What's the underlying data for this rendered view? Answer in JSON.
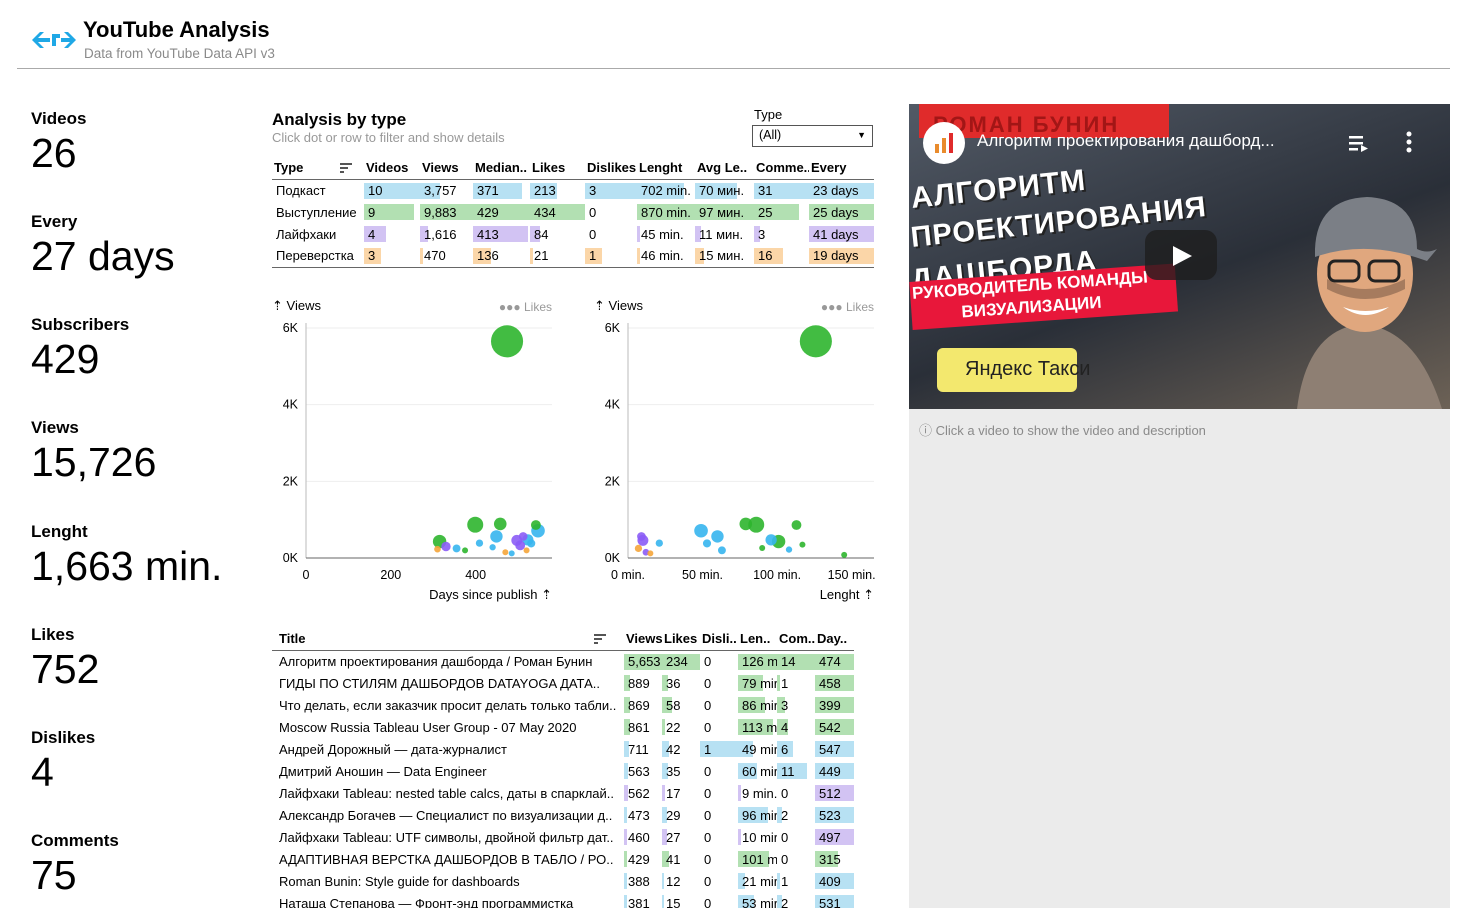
{
  "header": {
    "title": "YouTube Analysis",
    "subtitle": "Data from YouTube Data API v3"
  },
  "kpis": [
    {
      "label": "Videos",
      "value": "26"
    },
    {
      "label": "Every",
      "value": "27 days"
    },
    {
      "label": "Subscribers",
      "value": "429"
    },
    {
      "label": "Views",
      "value": "15,726"
    },
    {
      "label": "Lenght",
      "value": "1,663 min."
    },
    {
      "label": "Likes",
      "value": "752"
    },
    {
      "label": "Dislikes",
      "value": "4"
    },
    {
      "label": "Comments",
      "value": "75"
    }
  ],
  "analysis": {
    "title": "Analysis by type",
    "hint": "Click dot or row to filter and show details",
    "filter_label": "Type",
    "filter_value": "(All)"
  },
  "colors": {
    "Подкаст": "#b7e1f3",
    "Выступление": "#b2e0b2",
    "Лайфхаки": "#d2c3f3",
    "Переверстка": "#fbd6a8",
    "dot_blue": "#36b5ee",
    "dot_green": "#2db52d",
    "dot_purple": "#8b5cf6",
    "dot_orange": "#f5a53a"
  },
  "type_table": {
    "headers": [
      "Type",
      "Videos",
      "Views",
      "Median..",
      "Likes",
      "Dislikes",
      "Lenght",
      "Avg Le..",
      "Comme..",
      "Every"
    ],
    "rows": [
      {
        "type": "Подкаст",
        "cells": [
          "10",
          "3,757",
          "371",
          "213",
          "3",
          "702 min.",
          "70 мин.",
          "31",
          "23 days"
        ],
        "fill": [
          1.0,
          0.38,
          0.86,
          0.49,
          1.0,
          0.81,
          0.72,
          1.0,
          1.0
        ]
      },
      {
        "type": "Выступление",
        "cells": [
          "9",
          "9,883",
          "429",
          "434",
          "0",
          "870 min.",
          "97 мин.",
          "25",
          "25 days"
        ],
        "fill": [
          0.9,
          1.0,
          1.0,
          1.0,
          0.0,
          1.0,
          1.0,
          0.81,
          1.0
        ]
      },
      {
        "type": "Лайфхаки",
        "cells": [
          "4",
          "1,616",
          "413",
          "84",
          "0",
          "45 min.",
          "11 мин.",
          "3",
          "41 days"
        ],
        "fill": [
          0.4,
          0.16,
          0.96,
          0.19,
          0.0,
          0.05,
          0.11,
          0.1,
          1.0
        ]
      },
      {
        "type": "Переверстка",
        "cells": [
          "3",
          "470",
          "136",
          "21",
          "1",
          "46 min.",
          "15 мин.",
          "16",
          "19 days"
        ],
        "fill": [
          0.3,
          0.05,
          0.32,
          0.05,
          0.33,
          0.05,
          0.15,
          0.52,
          1.0
        ]
      }
    ]
  },
  "chart_data": [
    {
      "type": "scatter",
      "title": "",
      "ylabel": "Views",
      "xlabel": "Days since publish",
      "legend": "Likes",
      "x_ticks": [
        "0",
        "200",
        "400"
      ],
      "y_ticks": [
        "0K",
        "2K",
        "4K",
        "6K"
      ],
      "xlim": [
        0,
        580
      ],
      "ylim": [
        0,
        6000
      ],
      "points": [
        {
          "x": 474,
          "y": 5653,
          "likes": 234,
          "type": "Выступление"
        },
        {
          "x": 458,
          "y": 889,
          "likes": 36,
          "type": "Выступление"
        },
        {
          "x": 399,
          "y": 869,
          "likes": 58,
          "type": "Выступление"
        },
        {
          "x": 542,
          "y": 861,
          "likes": 22,
          "type": "Выступление"
        },
        {
          "x": 547,
          "y": 711,
          "likes": 42,
          "type": "Подкаст"
        },
        {
          "x": 449,
          "y": 563,
          "likes": 35,
          "type": "Подкаст"
        },
        {
          "x": 512,
          "y": 562,
          "likes": 17,
          "type": "Лайфхаки"
        },
        {
          "x": 523,
          "y": 473,
          "likes": 29,
          "type": "Подкаст"
        },
        {
          "x": 497,
          "y": 460,
          "likes": 27,
          "type": "Лайфхаки"
        },
        {
          "x": 315,
          "y": 429,
          "likes": 41,
          "type": "Выступление"
        },
        {
          "x": 409,
          "y": 388,
          "likes": 12,
          "type": "Подкаст"
        },
        {
          "x": 531,
          "y": 381,
          "likes": 15,
          "type": "Подкаст"
        },
        {
          "x": 330,
          "y": 300,
          "likes": 20,
          "type": "Лайфхаки"
        },
        {
          "x": 310,
          "y": 230,
          "likes": 10,
          "type": "Переверстка"
        },
        {
          "x": 355,
          "y": 250,
          "likes": 14,
          "type": "Подкаст"
        },
        {
          "x": 375,
          "y": 200,
          "likes": 8,
          "type": "Выступление"
        },
        {
          "x": 440,
          "y": 280,
          "likes": 9,
          "type": "Подкаст"
        },
        {
          "x": 470,
          "y": 150,
          "likes": 7,
          "type": "Переверстка"
        },
        {
          "x": 485,
          "y": 120,
          "likes": 6,
          "type": "Подкаст"
        },
        {
          "x": 505,
          "y": 330,
          "likes": 22,
          "type": "Лайфхаки"
        },
        {
          "x": 520,
          "y": 200,
          "likes": 8,
          "type": "Переверстка"
        }
      ]
    },
    {
      "type": "scatter",
      "title": "",
      "ylabel": "Views",
      "xlabel": "Lenght",
      "legend": "Likes",
      "x_ticks": [
        "0 min.",
        "50 min.",
        "100 min.",
        "150 min."
      ],
      "y_ticks": [
        "0K",
        "2K",
        "4K",
        "6K"
      ],
      "xlim": [
        0,
        165
      ],
      "ylim": [
        0,
        6000
      ],
      "points": [
        {
          "x": 126,
          "y": 5653,
          "likes": 234,
          "type": "Выступление"
        },
        {
          "x": 79,
          "y": 889,
          "likes": 36,
          "type": "Выступление"
        },
        {
          "x": 86,
          "y": 869,
          "likes": 58,
          "type": "Выступление"
        },
        {
          "x": 113,
          "y": 861,
          "likes": 22,
          "type": "Выступление"
        },
        {
          "x": 49,
          "y": 711,
          "likes": 42,
          "type": "Подкаст"
        },
        {
          "x": 60,
          "y": 563,
          "likes": 35,
          "type": "Подкаст"
        },
        {
          "x": 9,
          "y": 562,
          "likes": 17,
          "type": "Лайфхаки"
        },
        {
          "x": 96,
          "y": 473,
          "likes": 29,
          "type": "Подкаст"
        },
        {
          "x": 10,
          "y": 460,
          "likes": 27,
          "type": "Лайфхаки"
        },
        {
          "x": 101,
          "y": 429,
          "likes": 41,
          "type": "Выступление"
        },
        {
          "x": 21,
          "y": 388,
          "likes": 12,
          "type": "Подкаст"
        },
        {
          "x": 53,
          "y": 381,
          "likes": 15,
          "type": "Подкаст"
        },
        {
          "x": 7,
          "y": 250,
          "likes": 12,
          "type": "Переверстка"
        },
        {
          "x": 12,
          "y": 150,
          "likes": 10,
          "type": "Лайфхаки"
        },
        {
          "x": 15,
          "y": 120,
          "likes": 6,
          "type": "Переверстка"
        },
        {
          "x": 63,
          "y": 200,
          "likes": 14,
          "type": "Подкаст"
        },
        {
          "x": 90,
          "y": 260,
          "likes": 8,
          "type": "Выступление"
        },
        {
          "x": 117,
          "y": 350,
          "likes": 6,
          "type": "Выступление"
        },
        {
          "x": 145,
          "y": 80,
          "likes": 5,
          "type": "Выступление"
        },
        {
          "x": 108,
          "y": 220,
          "likes": 9,
          "type": "Подкаст"
        }
      ]
    }
  ],
  "video_table": {
    "headers": [
      "Title",
      "Views",
      "Likes",
      "Disli..",
      "Len..",
      "Com..",
      "Day.."
    ],
    "rows": [
      {
        "type": "Выступление",
        "title": "Алгоритм проектирования дашборда / Роман Бунин",
        "cells": [
          "5,653",
          "234",
          "0",
          "126 m",
          "14",
          "474"
        ],
        "fill": [
          1.0,
          1.0,
          0.0,
          1.0,
          1.0,
          1.0
        ]
      },
      {
        "type": "Выступление",
        "title": "ГИДЫ ПО СТИЛЯМ ДАШБОРДОВ   DATAYOGA ДАТА..",
        "cells": [
          "889",
          "36",
          "0",
          "79 mir",
          "1",
          "458"
        ],
        "fill": [
          0.16,
          0.15,
          0.0,
          0.63,
          0.07,
          1.0
        ]
      },
      {
        "type": "Выступление",
        "title": "Что делать, если заказчик просит делать только табли..",
        "cells": [
          "869",
          "58",
          "0",
          "86 mir",
          "3",
          "399"
        ],
        "fill": [
          0.15,
          0.25,
          0.0,
          0.68,
          0.21,
          1.0
        ]
      },
      {
        "type": "Выступление",
        "title": "Moscow Russia Tableau User Group - 07 May 2020",
        "cells": [
          "861",
          "22",
          "0",
          "113 m",
          "4",
          "542"
        ],
        "fill": [
          0.15,
          0.09,
          0.0,
          0.9,
          0.29,
          1.0
        ]
      },
      {
        "type": "Подкаст",
        "title": "Андрей Дорожный — дата-журналист",
        "cells": [
          "711",
          "42",
          "1",
          "49 mir",
          "6",
          "547"
        ],
        "fill": [
          0.13,
          0.18,
          1.0,
          0.39,
          0.43,
          1.0
        ]
      },
      {
        "type": "Подкаст",
        "title": "Дмитрий Аношин — Data Engineer",
        "cells": [
          "563",
          "35",
          "0",
          "60 mir",
          "11",
          "449"
        ],
        "fill": [
          0.1,
          0.15,
          0.0,
          0.48,
          0.79,
          1.0
        ]
      },
      {
        "type": "Лайфхаки",
        "title": "Лайфхаки Tableau: nested table calcs, даты в спарклай..",
        "cells": [
          "562",
          "17",
          "0",
          "9 min.",
          "0",
          "512"
        ],
        "fill": [
          0.1,
          0.07,
          0.0,
          0.07,
          0.0,
          1.0
        ]
      },
      {
        "type": "Подкаст",
        "title": "Александр Богачев — Специалист по визуализации д..",
        "cells": [
          "473",
          "29",
          "0",
          "96 mir",
          "2",
          "523"
        ],
        "fill": [
          0.08,
          0.12,
          0.0,
          0.76,
          0.14,
          1.0
        ]
      },
      {
        "type": "Лайфхаки",
        "title": "Лайфхаки Tableau: UTF символы, двойной фильтр дат..",
        "cells": [
          "460",
          "27",
          "0",
          "10 mir",
          "0",
          "497"
        ],
        "fill": [
          0.08,
          0.12,
          0.0,
          0.08,
          0.0,
          1.0
        ]
      },
      {
        "type": "Выступление",
        "title": "АДАПТИВНАЯ ВЕРСТКА ДАШБОРДОВ В ТАБЛО / РО..",
        "cells": [
          "429",
          "41",
          "0",
          "101 m",
          "0",
          "315"
        ],
        "fill": [
          0.08,
          0.18,
          0.0,
          0.8,
          0.0,
          0.6
        ]
      },
      {
        "type": "Подкаст",
        "title": "Roman Bunin: Style guide for dashboards",
        "cells": [
          "388",
          "12",
          "0",
          "21 mir",
          "1",
          "409"
        ],
        "fill": [
          0.07,
          0.05,
          0.0,
          0.17,
          0.07,
          1.0
        ]
      },
      {
        "type": "Подкаст",
        "title": "Наташа Степанова — Фронт-энд программистка",
        "cells": [
          "381",
          "15",
          "0",
          "53 mir",
          "2",
          "531"
        ],
        "fill": [
          0.07,
          0.06,
          0.0,
          0.42,
          0.14,
          1.0
        ]
      }
    ]
  },
  "video_panel": {
    "video_title": "Алгоритм проектирования дашборд...",
    "banner_text": "РОМАН БУНИН",
    "thumb_lines": [
      "АЛГОРИТМ",
      "ПРОЕКТИРОВАНИЯ",
      "ДАШБОРДА"
    ],
    "tag_lines": [
      "РУКОВОДИТЕЛЬ КОМАНДЫ",
      "ВИЗУАЛИЗАЦИИ"
    ],
    "taxi_text": "Яндекс Такси",
    "hint": "Click a video to show the video and description"
  }
}
